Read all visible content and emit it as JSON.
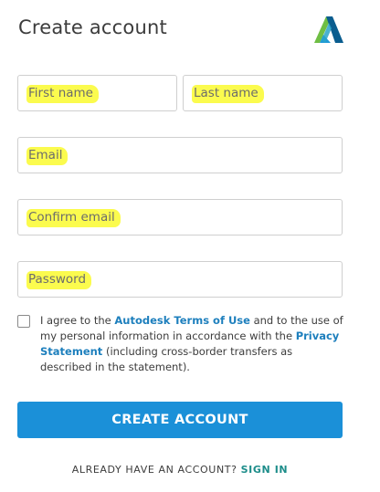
{
  "title": "Create account",
  "brand_logo": "autodesk-logo",
  "fields": {
    "first_name_placeholder": "First name",
    "last_name_placeholder": "Last name",
    "email_placeholder": "Email",
    "confirm_email_placeholder": "Confirm email",
    "password_placeholder": "Password"
  },
  "consent": {
    "checked": false,
    "text_1": "I agree to the ",
    "terms_link": "Autodesk Terms of Use",
    "text_2": " and to the use of my personal information in accordance with the ",
    "privacy_link": "Privacy Statement",
    "text_3": " (including cross-border transfers as described in the statement)."
  },
  "create_button_label": "CREATE ACCOUNT",
  "signin": {
    "prompt": "ALREADY HAVE AN ACCOUNT?",
    "link": "SIGN IN"
  },
  "colors": {
    "accent_blue": "#1b90d8",
    "link_blue": "#1d7fbd",
    "signin_teal": "#1d8d8a",
    "highlight_yellow": "#fbfb4e"
  }
}
